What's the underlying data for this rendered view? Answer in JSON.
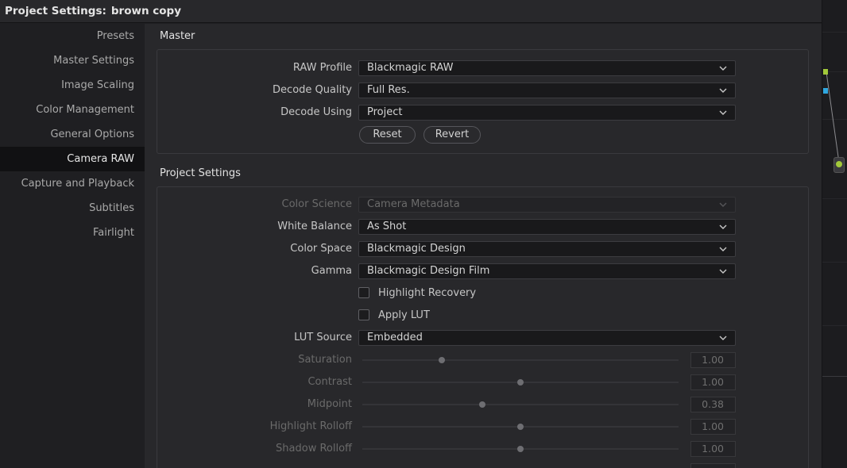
{
  "window": {
    "title_prefix": "Project Settings:",
    "title_project": "brown copy"
  },
  "sidebar": {
    "items": [
      {
        "label": "Presets"
      },
      {
        "label": "Master Settings"
      },
      {
        "label": "Image Scaling"
      },
      {
        "label": "Color Management"
      },
      {
        "label": "General Options"
      },
      {
        "label": "Camera RAW"
      },
      {
        "label": "Capture and Playback"
      },
      {
        "label": "Subtitles"
      },
      {
        "label": "Fairlight"
      }
    ],
    "active": "Camera RAW"
  },
  "master": {
    "title": "Master",
    "raw_profile": {
      "label": "RAW Profile",
      "value": "Blackmagic RAW"
    },
    "decode_quality": {
      "label": "Decode Quality",
      "value": "Full Res."
    },
    "decode_using": {
      "label": "Decode Using",
      "value": "Project"
    },
    "reset_label": "Reset",
    "revert_label": "Revert"
  },
  "project": {
    "title": "Project Settings",
    "color_science": {
      "label": "Color Science",
      "value": "Camera Metadata"
    },
    "white_balance": {
      "label": "White Balance",
      "value": "As Shot"
    },
    "color_space": {
      "label": "Color Space",
      "value": "Blackmagic Design"
    },
    "gamma": {
      "label": "Gamma",
      "value": "Blackmagic Design Film"
    },
    "highlight_recovery": {
      "label": "Highlight Recovery",
      "checked": false
    },
    "apply_lut": {
      "label": "Apply LUT",
      "checked": false
    },
    "lut_source": {
      "label": "LUT Source",
      "value": "Embedded"
    },
    "sliders": [
      {
        "label": "Saturation",
        "value": "1.00",
        "fraction": 0.25
      },
      {
        "label": "Contrast",
        "value": "1.00",
        "fraction": 0.5
      },
      {
        "label": "Midpoint",
        "value": "0.38",
        "fraction": 0.38
      },
      {
        "label": "Highlight Rolloff",
        "value": "1.00",
        "fraction": 0.5
      },
      {
        "label": "Shadow Rolloff",
        "value": "1.00",
        "fraction": 0.5
      }
    ]
  },
  "colors": {
    "accent_green": "#a2c93a",
    "accent_blue": "#2fa7e0"
  }
}
